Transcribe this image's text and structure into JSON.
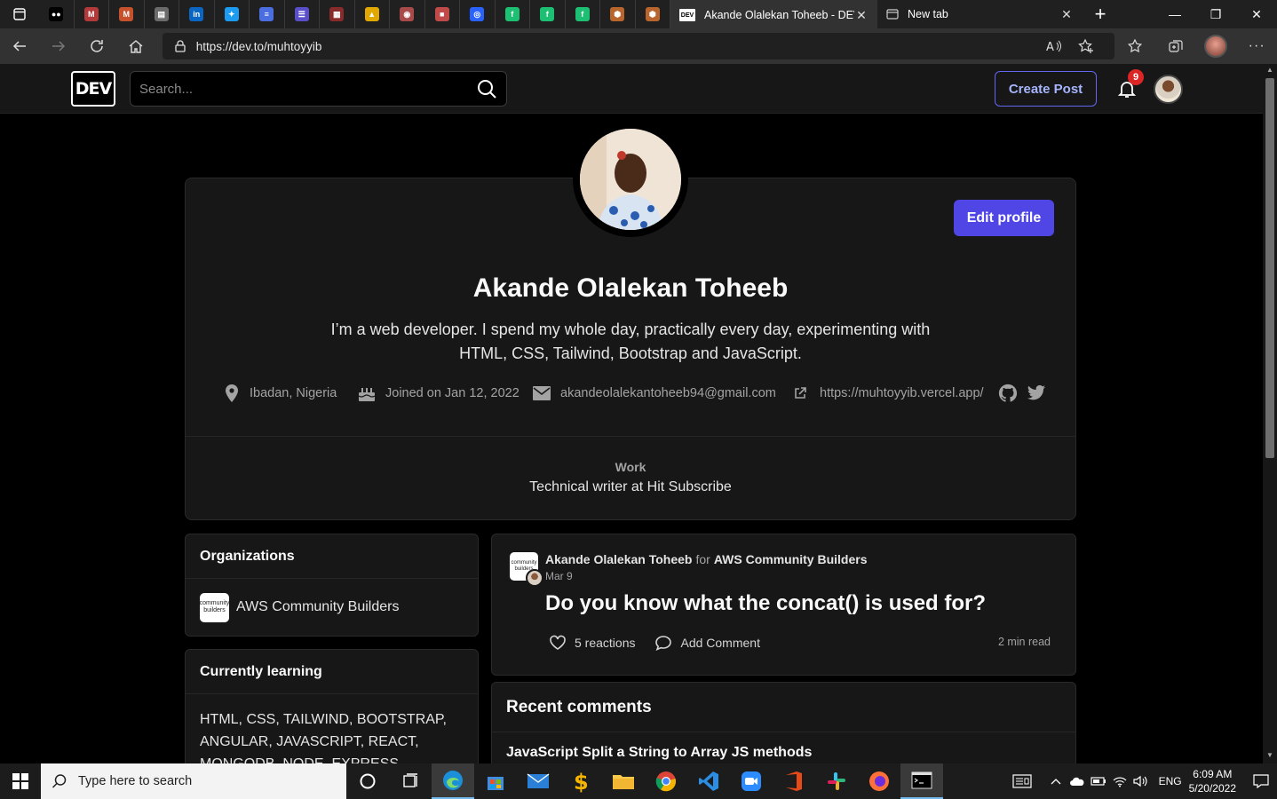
{
  "browser": {
    "active_tab_title": "Akande Olalekan Toheeb - DEV",
    "inactive_tab_title": "New tab",
    "url": "https://dev.to/muhtoyyib",
    "pinned_tabs": [
      {
        "icon": "medium-icon",
        "color": "#000000",
        "glyph": "●●"
      },
      {
        "icon": "gmail-icon",
        "color": "#b33a3a",
        "glyph": "M"
      },
      {
        "icon": "gmail-icon",
        "color": "#c5522d",
        "glyph": "M"
      },
      {
        "icon": "terminal-doc-icon",
        "color": "#6b6b6b",
        "glyph": "▤"
      },
      {
        "icon": "linkedin-icon",
        "color": "#0a66c2",
        "glyph": "in"
      },
      {
        "icon": "twitter-icon",
        "color": "#1d9bf0",
        "glyph": "✦"
      },
      {
        "icon": "docs-icon",
        "color": "#4a6ee0",
        "glyph": "≡"
      },
      {
        "icon": "list-icon",
        "color": "#5b4fc9",
        "glyph": "☰"
      },
      {
        "icon": "app-icon",
        "color": "#8a2b2b",
        "glyph": "▦"
      },
      {
        "icon": "drive-icon",
        "color": "#e0a800",
        "glyph": "▲"
      },
      {
        "icon": "circle-app-icon",
        "color": "#a84a4a",
        "glyph": "◉"
      },
      {
        "icon": "app-icon",
        "color": "#c04a4a",
        "glyph": "■"
      },
      {
        "icon": "hashnode-icon",
        "color": "#2962ff",
        "glyph": "◎"
      },
      {
        "icon": "fiverr-icon",
        "color": "#1dbf73",
        "glyph": "f"
      },
      {
        "icon": "fiverr-icon",
        "color": "#1dbf73",
        "glyph": "f"
      },
      {
        "icon": "fiverr-icon",
        "color": "#1dbf73",
        "glyph": "f"
      },
      {
        "icon": "box-icon",
        "color": "#b8662e",
        "glyph": "⬢"
      },
      {
        "icon": "box-icon",
        "color": "#b8662e",
        "glyph": "⬢"
      }
    ]
  },
  "dev": {
    "logo": "DEV",
    "search_placeholder": "Search...",
    "create_post": "Create Post",
    "notification_count": "9"
  },
  "profile": {
    "name": "Akande Olalekan Toheeb",
    "bio": "I’m a web developer. I spend my whole day, practically every day, experimenting with HTML, CSS, Tailwind, Bootstrap and JavaScript.",
    "location": "Ibadan, Nigeria",
    "joined": "Joined on Jan 12, 2022",
    "email": "akandeolalekantoheeb94@gmail.com",
    "website": "https://muhtoyyib.vercel.app/",
    "edit_button": "Edit profile",
    "work_label": "Work",
    "work_value": "Technical writer at Hit Subscribe"
  },
  "sidebar": {
    "organizations_title": "Organizations",
    "organization_name": "AWS Community Builders",
    "organization_logo_text": "community builders",
    "learning_title": "Currently learning",
    "learning_text": "HTML, CSS, TAILWIND, BOOTSTRAP, ANGULAR, JAVASCRIPT, REACT, MONGODB, NODE, EXPRESS"
  },
  "post": {
    "author": "Akande Olalekan Toheeb",
    "for_label": "for",
    "org": "AWS Community Builders",
    "date": "Mar 9",
    "title": "Do you know what the concat() is used for?",
    "reactions": "5 reactions",
    "comment": "Add Comment",
    "read_time": "2 min read"
  },
  "recent_comments": {
    "title": "Recent comments",
    "first_item": "JavaScript Split a String to Array JS methods"
  },
  "taskbar": {
    "search_placeholder": "Type here to search",
    "language": "ENG",
    "time": "6:09 AM",
    "date": "5/20/2022"
  }
}
